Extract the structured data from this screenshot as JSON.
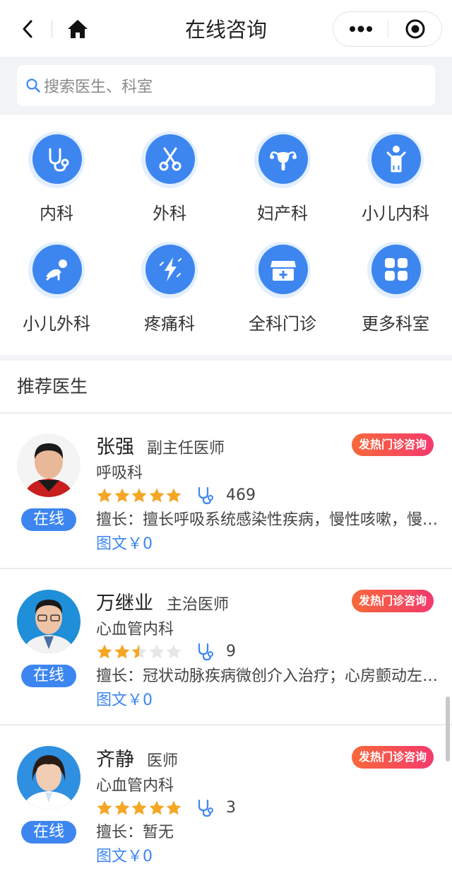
{
  "nav": {
    "title": "在线咨询",
    "back_icon": "chevron-left-icon",
    "home_icon": "home-icon"
  },
  "search": {
    "placeholder": "搜索医生、科室"
  },
  "departments": [
    {
      "label": "内科",
      "icon": "stethoscope-icon"
    },
    {
      "label": "外科",
      "icon": "scissors-icon"
    },
    {
      "label": "妇产科",
      "icon": "uterus-icon"
    },
    {
      "label": "小儿内科",
      "icon": "child-icon"
    },
    {
      "label": "小儿外科",
      "icon": "crawling-baby-icon"
    },
    {
      "label": "疼痛科",
      "icon": "lightning-icon"
    },
    {
      "label": "全科门诊",
      "icon": "clinic-icon"
    },
    {
      "label": "更多科室",
      "icon": "grid-icon"
    }
  ],
  "section": {
    "title": "推荐医生"
  },
  "doctors": [
    {
      "name": "张强",
      "title": "副主任医师",
      "dept": "呼吸科",
      "rating": 5,
      "count": "469",
      "specialty": "擅长：擅长呼吸系统感染性疾病，慢性咳嗽，慢…",
      "price": "图文￥0",
      "status": "在线",
      "badge": "发热门诊咨询"
    },
    {
      "name": "万继业",
      "title": "主治医师",
      "dept": "心血管内科",
      "rating": 2.5,
      "count": "9",
      "specialty": "擅长：冠状动脉疾病微创介入治疗；心房颤动左…",
      "price": "图文￥0",
      "status": "在线",
      "badge": "发热门诊咨询"
    },
    {
      "name": "齐静",
      "title": "医师",
      "dept": "心血管内科",
      "rating": 5,
      "count": "3",
      "specialty": "擅长：暂无",
      "price": "图文￥0",
      "status": "在线",
      "badge": "发热门诊咨询"
    }
  ],
  "colors": {
    "accent": "#3d86f0",
    "star": "#f5a623",
    "star_empty": "#e6e6e6",
    "badge_from": "#f7683a",
    "badge_to": "#f43a6d"
  }
}
